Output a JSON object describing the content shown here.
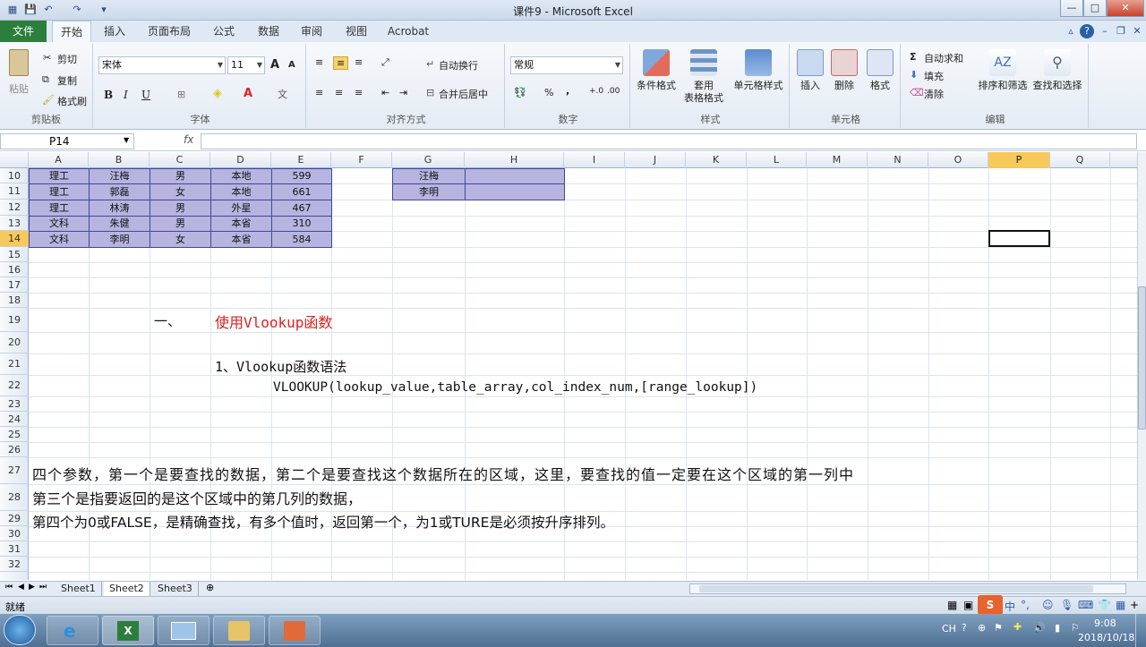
{
  "window": {
    "title": "课件9 - Microsoft Excel",
    "min": "—",
    "max": "□",
    "close": "✕"
  },
  "tabs": [
    "文件",
    "开始",
    "插入",
    "页面布局",
    "公式",
    "数据",
    "审阅",
    "视图",
    "Acrobat"
  ],
  "ribbon": {
    "clipboard": {
      "paste": "粘贴",
      "cut": "剪切",
      "copy": "复制",
      "format_painter": "格式刷",
      "label": "剪贴板"
    },
    "font": {
      "name": "宋体",
      "size": "11",
      "label": "字体",
      "bold": "B",
      "italic": "I",
      "underline": "U",
      "grow": "A",
      "shrink": "A"
    },
    "alignment": {
      "wrap": "自动换行",
      "merge": "合并后居中",
      "label": "对齐方式"
    },
    "number": {
      "format": "常规",
      "percent": "%",
      "comma": ",",
      "label": "数字"
    },
    "styles": {
      "conditional": "条件格式",
      "table_fmt_1": "套用",
      "table_fmt_2": "表格格式",
      "cell_style": "单元格样式",
      "label": "样式"
    },
    "cells": {
      "insert": "插入",
      "delete": "删除",
      "format": "格式",
      "label": "单元格"
    },
    "editing": {
      "autosum": "自动求和",
      "fill": "填充",
      "clear": "清除",
      "sort": "排序和筛选",
      "find": "查找和选择",
      "label": "编辑"
    }
  },
  "formula_bar": {
    "name_box": "P14",
    "fx": "fx",
    "value": ""
  },
  "columns": [
    "A",
    "B",
    "C",
    "D",
    "E",
    "F",
    "G",
    "H",
    "I",
    "J",
    "K",
    "L",
    "M",
    "N",
    "O",
    "P",
    "Q"
  ],
  "rows": [
    "10",
    "11",
    "12",
    "13",
    "14",
    "15",
    "16",
    "17",
    "18",
    "19",
    "20",
    "21",
    "22",
    "23",
    "24",
    "25",
    "26",
    "27",
    "28",
    "29",
    "30",
    "31",
    "32"
  ],
  "table": [
    [
      "理工",
      "汪梅",
      "男",
      "本地",
      "599"
    ],
    [
      "理工",
      "郭磊",
      "女",
      "本地",
      "661"
    ],
    [
      "理工",
      "林涛",
      "男",
      "外星",
      "467"
    ],
    [
      "文科",
      "朱健",
      "男",
      "本省",
      "310"
    ],
    [
      "文科",
      "李明",
      "女",
      "本省",
      "584"
    ]
  ],
  "lookup_names": [
    "汪梅",
    "李明"
  ],
  "text": {
    "section_num": "一、",
    "section_title": "使用Vlookup函数",
    "syntax_heading": "1、Vlookup函数语法",
    "syntax": "VLOOKUP(lookup_value,table_array,col_index_num,[range_lookup])",
    "para1": "四个参数，第一个是要查找的数据，第二个是要查找这个数据所在的区域，这里，要查找的值一定要在这个区域的第一列中",
    "para2": "第三个是指要返回的是这个区域中的第几列的数据，",
    "para3": "第四个为0或FALSE，是精确查找，有多个值时，返回第一个，为1或TURE是必须按升序排列。"
  },
  "sheets": [
    "Sheet1",
    "Sheet2",
    "Sheet3"
  ],
  "status": {
    "ready": "就绪"
  },
  "taskbar": {
    "lang": "CH",
    "time": "9:08",
    "date": "2018/10/18"
  },
  "accent": {
    "file_tab": "#2b7e3c",
    "table_fill": "#b7b4e0",
    "selected_header": "#f7c95b",
    "red_text": "#e02020"
  }
}
